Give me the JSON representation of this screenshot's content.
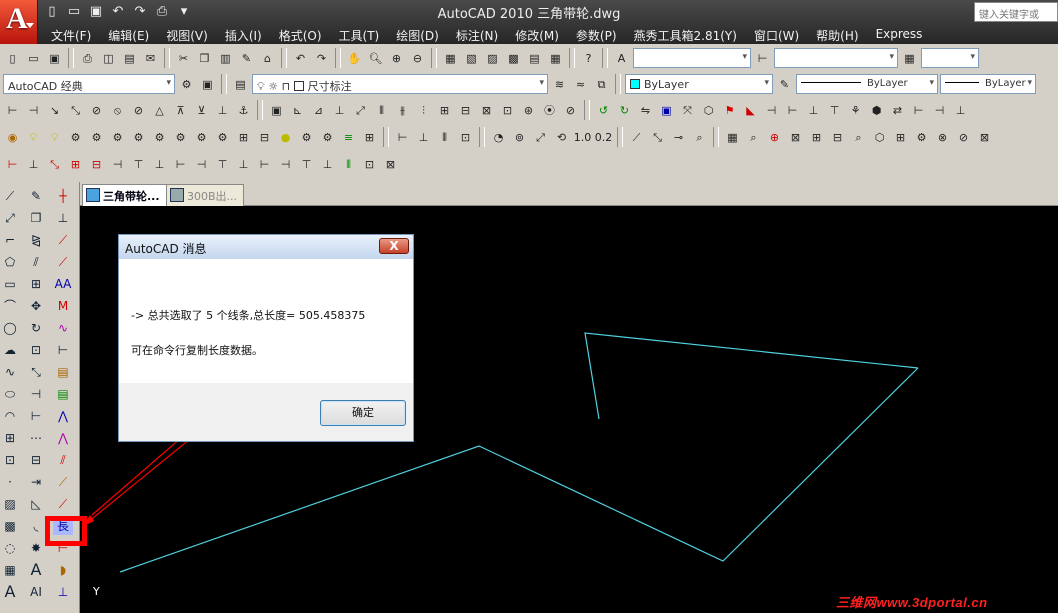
{
  "app": {
    "logo_letter": "A",
    "title": "AutoCAD 2010    三角带轮.dwg",
    "search_placeholder": "键入关键字或"
  },
  "menus": [
    "文件(F)",
    "编辑(E)",
    "视图(V)",
    "插入(I)",
    "格式(O)",
    "工具(T)",
    "绘图(D)",
    "标注(N)",
    "修改(M)",
    "参数(P)",
    "燕秀工具箱2.81(Y)",
    "窗口(W)",
    "帮助(H)",
    "Express"
  ],
  "toolbars": {
    "workspace": "AutoCAD 经典",
    "dimstyle_layer": "尺寸标注",
    "color": "ByLayer",
    "linetype": "ByLayer",
    "lineweight": "ByLayer",
    "scale_a": "1.0",
    "scale_b": "0.2"
  },
  "tabs": [
    {
      "label": "三角带轮..."
    },
    {
      "label": "300B出..."
    }
  ],
  "dialog": {
    "title": "AutoCAD 消息",
    "close_glyph": "X",
    "message_line1": "-> 总共选取了 5 个线条,总长度= 505.458375",
    "message_line2": "可在命令行复制长度数据。",
    "ok_label": "确定"
  },
  "side_tool_highlight": "長",
  "ucs_label": "Y",
  "watermark": "三维网www.3dportal.cn",
  "colors": {
    "canvas": "#000000",
    "polyline": "#4fd1e0",
    "annotation": "#ff0000",
    "toolbar": "#d4d0c8",
    "titlebar": "#333333"
  }
}
